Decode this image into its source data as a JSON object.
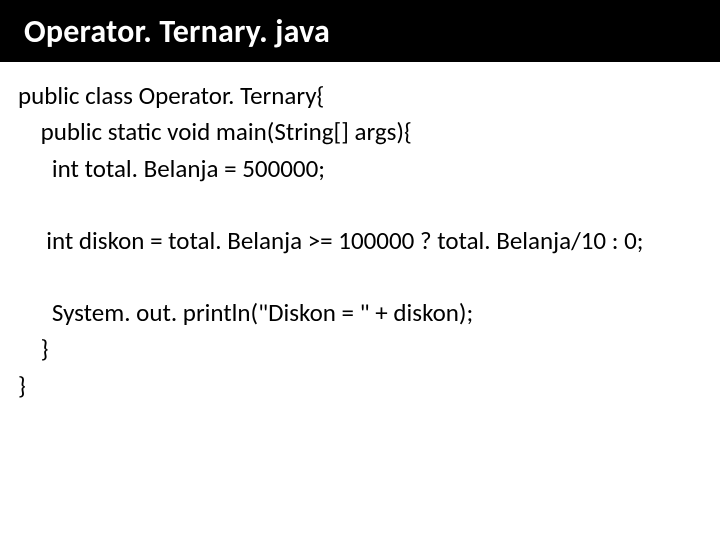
{
  "title": "Operator. Ternary. java",
  "code": {
    "l1": "public class Operator. Ternary{",
    "l2": "    public static void main(String[] args){",
    "l3": "      int total. Belanja = 500000;",
    "l4": "     int diskon = total. Belanja >= 100000 ? total. Belanja/10 : 0;",
    "l5": "      System. out. println(\"Diskon = \" + diskon);",
    "l6": "    }",
    "l7": "}"
  }
}
